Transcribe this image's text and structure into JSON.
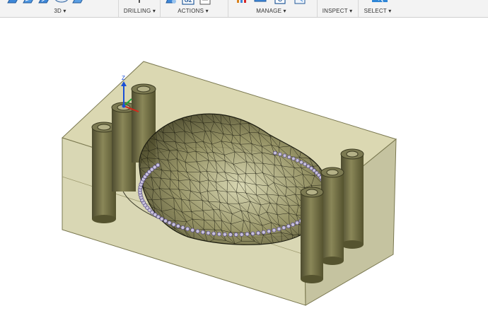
{
  "toolbar": {
    "groups": [
      {
        "label": "3D",
        "dropdown_icon": "triangle-down-icon"
      },
      {
        "label": "DRILLING",
        "dropdown_icon": "triangle-down-icon"
      },
      {
        "label": "ACTIONS",
        "dropdown_icon": "triangle-down-icon"
      },
      {
        "label": "MANAGE",
        "dropdown_icon": "triangle-down-icon"
      },
      {
        "label": "INSPECT",
        "dropdown_icon": "triangle-down-icon"
      },
      {
        "label": "SELECT",
        "dropdown_icon": "triangle-down-icon"
      }
    ],
    "icons": {
      "3d": [
        "contour-icon",
        "pocket-icon",
        "parallel-icon",
        "scallop-icon",
        "spiral-icon"
      ],
      "drilling": [
        "drill-icon"
      ],
      "actions": [
        "simulate-icon",
        "post-process-g2-icon",
        "setup-sheet-icon"
      ],
      "manage": [
        "tool-library-icon",
        "template-library-icon",
        "post-library-icon",
        "task-manager-icon"
      ],
      "inspect": [
        "measure-icon"
      ],
      "select": [
        "select-arrow-icon"
      ]
    },
    "dropdown_glyph": "▾",
    "g2_text": "G2",
    "g_text": "G"
  },
  "viewport": {
    "axis_label": "Z",
    "colors": {
      "stock_fill": "#c9c68e",
      "stock_edge": "#6e6c45",
      "cylinder": "#6c6944",
      "mesh": "#1c1c10",
      "toolpath": "#7a6fa0",
      "axis_z": "#1a4fd6",
      "axis_y": "#22a83a",
      "axis_x": "#d6261a",
      "toolbar_bg": "#f3f3f3"
    }
  }
}
